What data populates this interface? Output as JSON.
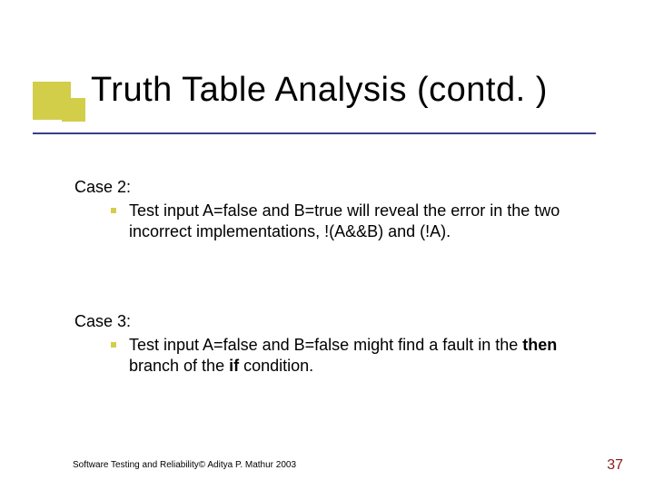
{
  "title": "Truth Table Analysis (contd. )",
  "case2": {
    "label": "Case 2:",
    "text": "Test input A=false and B=true will reveal the error in the two incorrect implementations, !(A&&B) and (!A)."
  },
  "case3": {
    "label": "Case 3:",
    "text_prefix": "Test input A=false and B=false might find a fault in the ",
    "then": "then",
    "mid": " branch of the ",
    "if": "if",
    "suffix": " condition."
  },
  "footer": "Software Testing and Reliability© Aditya P. Mathur 2003",
  "page": "37"
}
